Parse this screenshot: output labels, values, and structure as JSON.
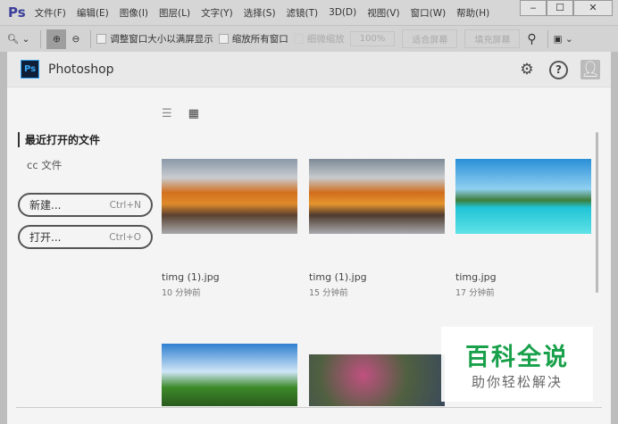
{
  "menubar": {
    "logo": "Ps",
    "items": [
      "文件(F)",
      "编辑(E)",
      "图像(I)",
      "图层(L)",
      "文字(Y)",
      "选择(S)",
      "滤镜(T)",
      "3D(D)",
      "视图(V)",
      "窗口(W)",
      "帮助(H)"
    ],
    "window_buttons": [
      "‒",
      "☐",
      "✕"
    ]
  },
  "toolbar": {
    "resize_windows": "调整窗口大小以满屏显示",
    "zoom_all": "缩放所有窗口",
    "scrubby": "细微缩放",
    "zoom_pct": "100%",
    "fit_screen": "适合屏幕",
    "fill_screen": "填充屏幕"
  },
  "header": {
    "logo": "Ps",
    "title": "Photoshop"
  },
  "sidebar": {
    "recent": "最近打开的文件",
    "cc": "cc 文件",
    "new_label": "新建...",
    "new_shortcut": "Ctrl+N",
    "open_label": "打开...",
    "open_shortcut": "Ctrl+O"
  },
  "files": [
    {
      "name": "timg (1).jpg",
      "time": "10 分钟前"
    },
    {
      "name": "timg (1).jpg",
      "time": "15 分钟前"
    },
    {
      "name": "timg.jpg",
      "time": "17 分钟前"
    }
  ],
  "watermark": {
    "line1": "百科全说",
    "line2": "助你轻松解决"
  }
}
